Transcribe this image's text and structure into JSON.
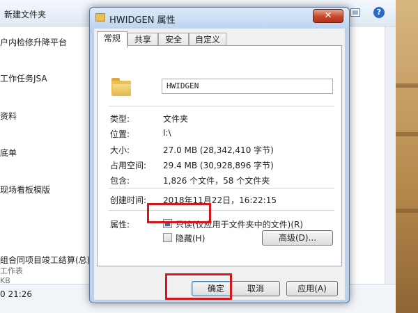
{
  "explorer": {
    "toolbar": {
      "new_folder": "新建文件夹",
      "help": "?"
    },
    "files": [
      {
        "name": "户内检修升降平台",
        "meta": ""
      },
      {
        "name": "工作任务JSA",
        "meta": ""
      },
      {
        "name": "资料",
        "meta": ""
      },
      {
        "name": "底单",
        "meta": ""
      },
      {
        "name": "现场看板模版",
        "meta": ""
      },
      {
        "name": "组合同项目竣工结算(总).xls",
        "meta": "工作表"
      }
    ],
    "size_fragment": "KB",
    "date_fragment": "0 21:26"
  },
  "dialog": {
    "title": "HWIDGEN 属性",
    "close": "✕",
    "tabs": [
      "常规",
      "共享",
      "安全",
      "自定义"
    ],
    "active_tab": 0,
    "folder_name": "HWIDGEN",
    "rows": [
      {
        "label": "类型:",
        "value": "文件夹"
      },
      {
        "label": "位置:",
        "value": "I:\\"
      },
      {
        "label": "大小:",
        "value": "27.0 MB (28,342,410 字节)"
      },
      {
        "label": "占用空间:",
        "value": "29.4 MB (30,928,896 字节)"
      },
      {
        "label": "包含:",
        "value": "1,826 个文件，58 个文件夹"
      }
    ],
    "created_label": "创建时间:",
    "created_value": "2018年11月22日，16:22:15",
    "attributes_label": "属性:",
    "readonly_label": "只读(仅应用于文件夹中的文件)(R)",
    "readonly_state": "indeterminate",
    "hidden_label": "隐藏(H)",
    "hidden_checked": false,
    "advanced_label": "高级(D)...",
    "ok_label": "确定",
    "cancel_label": "取消",
    "apply_label": "应用(A)"
  },
  "colors": {
    "highlight": "#d0181c",
    "dialog_frame": "#b9d1ea",
    "folder": "#e8c05a"
  }
}
